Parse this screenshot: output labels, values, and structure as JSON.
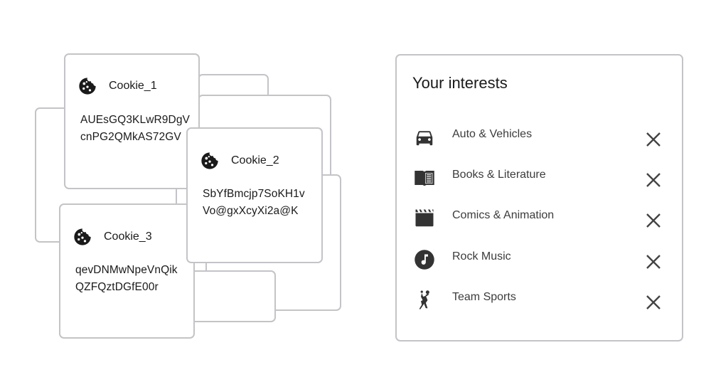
{
  "cookies": [
    {
      "name": "Cookie_1",
      "value_line1": "AUEsGQ3KLwR9DgV",
      "value_line2": "cnPG2QMkAS72GV",
      "icon": "cookie-icon"
    },
    {
      "name": "Cookie_2",
      "value_line1": "SbYfBmcjp7SoKH1v",
      "value_line2": "Vo@gxXcyXi2a@K",
      "icon": "cookie-icon"
    },
    {
      "name": "Cookie_3",
      "value_line1": "qevDNMwNpeVnQik",
      "value_line2": "QZFQztDGfE00r",
      "icon": "cookie-icon"
    }
  ],
  "interests": {
    "title": "Your interests",
    "items": [
      {
        "label": "Auto & Vehicles",
        "icon": "car-icon"
      },
      {
        "label": "Books & Literature",
        "icon": "book-icon"
      },
      {
        "label": "Comics & Animation",
        "icon": "clapperboard-icon"
      },
      {
        "label": "Rock Music",
        "icon": "music-note-icon"
      },
      {
        "label": "Team Sports",
        "icon": "sports-player-icon"
      }
    ],
    "remove_icon": "close-icon"
  }
}
